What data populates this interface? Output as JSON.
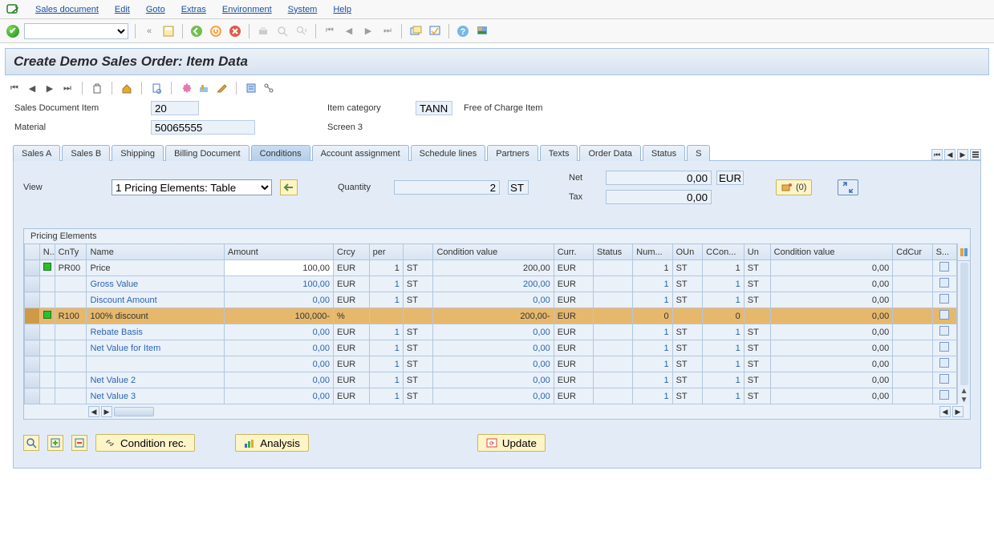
{
  "menu": {
    "items": [
      "Sales document",
      "Edit",
      "Goto",
      "Extras",
      "Environment",
      "System",
      "Help"
    ]
  },
  "title": "Create Demo Sales Order: Item Data",
  "header": {
    "sales_doc_item_label": "Sales Document Item",
    "sales_doc_item_value": "20",
    "item_category_label": "Item category",
    "item_category_value": "TANN",
    "item_category_desc": "Free of Charge Item",
    "material_label": "Material",
    "material_value": "50065555",
    "screen_label": "Screen 3"
  },
  "tabs": [
    "Sales A",
    "Sales B",
    "Shipping",
    "Billing Document",
    "Conditions",
    "Account assignment",
    "Schedule lines",
    "Partners",
    "Texts",
    "Order Data",
    "Status",
    "S"
  ],
  "tabs_active_index": 4,
  "conditions": {
    "view_label": "View",
    "view_value": "1 Pricing Elements: Table",
    "quantity_label": "Quantity",
    "quantity_value": "2",
    "quantity_unit": "ST",
    "net_label": "Net",
    "net_value": "0,00",
    "net_curr": "EUR",
    "tax_label": "Tax",
    "tax_value": "0,00",
    "doc_overview_btn": "(0)"
  },
  "pricing": {
    "caption": "Pricing Elements",
    "columns": [
      "N..",
      "CnTy",
      "Name",
      "Amount",
      "Crcy",
      "per",
      "",
      "Condition value",
      "Curr.",
      "Status",
      "Num...",
      "OUn",
      "CCon...",
      "Un",
      "Condition value",
      "CdCur",
      "S..."
    ],
    "rows": [
      {
        "marker": "green",
        "cnty": "PR00",
        "name": "Price",
        "amount": "100,00",
        "crcy": "EUR",
        "per": "1",
        "per_u": "ST",
        "cond_val": "200,00",
        "curr": "EUR",
        "num": "1",
        "oun": "ST",
        "ccon": "1",
        "un": "ST",
        "cond_val2": "0,00",
        "highlight": false,
        "blue": false,
        "white": true
      },
      {
        "marker": "",
        "cnty": "",
        "name": "Gross Value",
        "amount": "100,00",
        "crcy": "EUR",
        "per": "1",
        "per_u": "ST",
        "cond_val": "200,00",
        "curr": "EUR",
        "num": "1",
        "oun": "ST",
        "ccon": "1",
        "un": "ST",
        "cond_val2": "0,00",
        "highlight": false,
        "blue": true,
        "white": false
      },
      {
        "marker": "",
        "cnty": "",
        "name": "Discount Amount",
        "amount": "0,00",
        "crcy": "EUR",
        "per": "1",
        "per_u": "ST",
        "cond_val": "0,00",
        "curr": "EUR",
        "num": "1",
        "oun": "ST",
        "ccon": "1",
        "un": "ST",
        "cond_val2": "0,00",
        "highlight": false,
        "blue": true,
        "white": false
      },
      {
        "marker": "green",
        "cnty": "R100",
        "name": "100% discount",
        "amount": "100,000-",
        "crcy": "%",
        "per": "",
        "per_u": "",
        "cond_val": "200,00-",
        "curr": "EUR",
        "num": "0",
        "oun": "",
        "ccon": "0",
        "un": "",
        "cond_val2": "0,00",
        "highlight": true,
        "blue": false,
        "white": false
      },
      {
        "marker": "",
        "cnty": "",
        "name": "Rebate Basis",
        "amount": "0,00",
        "crcy": "EUR",
        "per": "1",
        "per_u": "ST",
        "cond_val": "0,00",
        "curr": "EUR",
        "num": "1",
        "oun": "ST",
        "ccon": "1",
        "un": "ST",
        "cond_val2": "0,00",
        "highlight": false,
        "blue": true,
        "white": false
      },
      {
        "marker": "",
        "cnty": "",
        "name": "Net Value for Item",
        "amount": "0,00",
        "crcy": "EUR",
        "per": "1",
        "per_u": "ST",
        "cond_val": "0,00",
        "curr": "EUR",
        "num": "1",
        "oun": "ST",
        "ccon": "1",
        "un": "ST",
        "cond_val2": "0,00",
        "highlight": false,
        "blue": true,
        "white": false
      },
      {
        "marker": "",
        "cnty": "",
        "name": "",
        "amount": "0,00",
        "crcy": "EUR",
        "per": "1",
        "per_u": "ST",
        "cond_val": "0,00",
        "curr": "EUR",
        "num": "1",
        "oun": "ST",
        "ccon": "1",
        "un": "ST",
        "cond_val2": "0,00",
        "highlight": false,
        "blue": true,
        "white": false
      },
      {
        "marker": "",
        "cnty": "",
        "name": "Net Value 2",
        "amount": "0,00",
        "crcy": "EUR",
        "per": "1",
        "per_u": "ST",
        "cond_val": "0,00",
        "curr": "EUR",
        "num": "1",
        "oun": "ST",
        "ccon": "1",
        "un": "ST",
        "cond_val2": "0,00",
        "highlight": false,
        "blue": true,
        "white": false
      },
      {
        "marker": "",
        "cnty": "",
        "name": "Net Value 3",
        "amount": "0,00",
        "crcy": "EUR",
        "per": "1",
        "per_u": "ST",
        "cond_val": "0,00",
        "curr": "EUR",
        "num": "1",
        "oun": "ST",
        "ccon": "1",
        "un": "ST",
        "cond_val2": "0,00",
        "highlight": false,
        "blue": true,
        "white": false
      }
    ]
  },
  "bottom": {
    "condition_rec": "Condition rec.",
    "analysis": "Analysis",
    "update": "Update"
  }
}
